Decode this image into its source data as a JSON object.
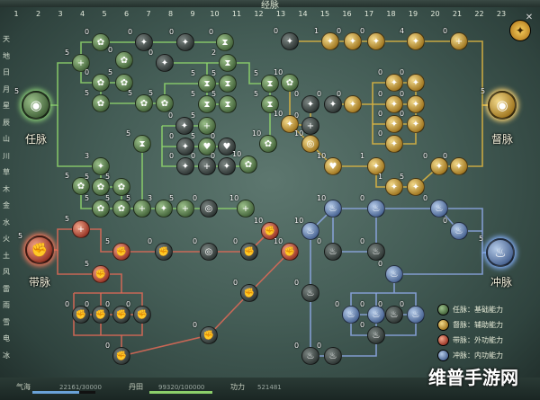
{
  "window": {
    "title": "经脉"
  },
  "columns": [
    "1",
    "2",
    "3",
    "4",
    "5",
    "6",
    "7",
    "8",
    "9",
    "10",
    "11",
    "12",
    "13",
    "14",
    "15",
    "16",
    "17",
    "18",
    "19",
    "20",
    "21",
    "22",
    "23"
  ],
  "rows": [
    "天",
    "地",
    "日",
    "月",
    "星",
    "辰",
    "山",
    "川",
    "草",
    "木",
    "金",
    "水",
    "火",
    "土",
    "风",
    "雷",
    "雨",
    "雪",
    "电",
    "冰"
  ],
  "meridians": [
    {
      "id": "ren",
      "name": "任脉",
      "level": "5",
      "icon": "eye-icon",
      "type": "green"
    },
    {
      "id": "du",
      "name": "督脉",
      "level": "5",
      "icon": "eye-icon",
      "type": "gold"
    },
    {
      "id": "dai",
      "name": "带脉",
      "level": "5",
      "icon": "fist-icon",
      "type": "red"
    },
    {
      "id": "chong",
      "name": "冲脉",
      "level": "5",
      "icon": "flame-icon",
      "type": "blue"
    }
  ],
  "legend": [
    {
      "label": "任脉：基础能力",
      "type": "green"
    },
    {
      "label": "督脉：辅助能力",
      "type": "gold"
    },
    {
      "label": "带脉：外功能力",
      "type": "red"
    },
    {
      "label": "冲脉：内功能力",
      "type": "blue"
    }
  ],
  "status": {
    "qihai_label": "气海",
    "qihai_value": "22161/30000",
    "qihai_fraction": 0.7387,
    "dantian_label": "丹田",
    "dantian_value": "99320/100000",
    "dantian_fraction": 0.9932,
    "gongli_label": "功力",
    "gongli_value": "521481"
  },
  "watermark": "维普手游网",
  "colors": {
    "green": "#6fb64d",
    "gold": "#c9a130",
    "red": "#c0483a",
    "blue": "#6e86c2",
    "dark": "#3a4240"
  },
  "nodes": [
    {
      "id": "g1",
      "type": "green",
      "icon": "plus-icon",
      "level": "5",
      "levelPos": "tl"
    },
    {
      "id": "g2",
      "type": "green",
      "icon": "flower-icon",
      "level": "0",
      "levelPos": "tl"
    },
    {
      "id": "g3",
      "type": "dark",
      "icon": "figure-icon",
      "level": "0",
      "levelPos": "tl"
    },
    {
      "id": "g4",
      "type": "dark",
      "icon": "figure-icon",
      "level": "0",
      "levelPos": "tl"
    },
    {
      "id": "g5",
      "type": "green",
      "icon": "flower-icon",
      "level": "0",
      "levelPos": "tl"
    },
    {
      "id": "g6",
      "type": "green",
      "icon": "flower-icon",
      "level": "0",
      "levelPos": "tl"
    },
    {
      "id": "g7",
      "type": "dark",
      "icon": "figure-icon",
      "level": "0",
      "levelPos": "tl"
    },
    {
      "id": "g8",
      "type": "green",
      "icon": "flower-icon",
      "level": "5",
      "levelPos": "tl"
    },
    {
      "id": "g9",
      "type": "green",
      "icon": "flower-icon",
      "level": "5",
      "levelPos": "tl"
    },
    {
      "id": "g10",
      "type": "green",
      "icon": "flower-icon",
      "level": "5",
      "levelPos": "tl"
    },
    {
      "id": "g11",
      "type": "green",
      "icon": "flower-icon",
      "level": "5",
      "levelPos": "tl"
    },
    {
      "id": "g12",
      "type": "green",
      "icon": "hourglass-icon",
      "level": "0",
      "levelPos": "tl"
    },
    {
      "id": "g13",
      "type": "green",
      "icon": "hourglass-icon",
      "level": "2",
      "levelPos": "tl"
    },
    {
      "id": "g14",
      "type": "green",
      "icon": "hourglass-icon",
      "level": "5",
      "levelPos": "tl"
    },
    {
      "id": "g15",
      "type": "green",
      "icon": "hourglass-icon",
      "level": "5",
      "levelPos": "tl"
    },
    {
      "id": "g16",
      "type": "green",
      "icon": "hourglass-icon",
      "level": "5",
      "levelPos": "tl"
    },
    {
      "id": "g17",
      "type": "green",
      "icon": "hourglass-icon",
      "level": "5",
      "levelPos": "tl"
    },
    {
      "id": "g18",
      "type": "green",
      "icon": "hourglass-icon",
      "level": "5",
      "levelPos": "tl"
    },
    {
      "id": "g19",
      "type": "green",
      "icon": "hourglass-icon",
      "level": "5",
      "levelPos": "tl"
    },
    {
      "id": "g20",
      "type": "green",
      "icon": "flower-icon",
      "level": "10",
      "levelPos": "tl"
    },
    {
      "id": "g21",
      "type": "green",
      "icon": "flower-icon",
      "level": "10",
      "levelPos": "tl"
    },
    {
      "id": "g22",
      "type": "green",
      "icon": "hourglass-icon",
      "level": "5",
      "levelPos": "tl"
    },
    {
      "id": "g23",
      "type": "green",
      "icon": "plus-icon",
      "level": "5",
      "levelPos": "tl"
    },
    {
      "id": "g24",
      "type": "green",
      "icon": "heart-icon",
      "level": "5",
      "levelPos": "tl"
    },
    {
      "id": "g25",
      "type": "dark",
      "icon": "heart-icon",
      "level": "0",
      "levelPos": "tl"
    },
    {
      "id": "g26",
      "type": "dark",
      "icon": "figure-icon",
      "level": "0",
      "levelPos": "tl"
    },
    {
      "id": "g27",
      "type": "dark",
      "icon": "plus-icon",
      "level": "0",
      "levelPos": "tl"
    },
    {
      "id": "g28",
      "type": "dark",
      "icon": "figure-icon",
      "level": "0",
      "levelPos": "tl"
    },
    {
      "id": "g29",
      "type": "dark",
      "icon": "figure-icon",
      "level": "0",
      "levelPos": "tl"
    },
    {
      "id": "g30",
      "type": "dark",
      "icon": "figure-icon",
      "level": "0",
      "levelPos": "tl"
    },
    {
      "id": "g31",
      "type": "green",
      "icon": "flower-icon",
      "level": "10",
      "levelPos": "tl"
    },
    {
      "id": "g32",
      "type": "green",
      "icon": "figure-icon",
      "level": "3",
      "levelPos": "tl"
    },
    {
      "id": "g33",
      "type": "green",
      "icon": "flower-icon",
      "level": "5",
      "levelPos": "tl"
    },
    {
      "id": "g34",
      "type": "green",
      "icon": "flower-icon",
      "level": "5",
      "levelPos": "tl"
    },
    {
      "id": "g35",
      "type": "green",
      "icon": "flower-icon",
      "level": "5",
      "levelPos": "tl"
    },
    {
      "id": "g36",
      "type": "green",
      "icon": "flower-icon",
      "level": "5",
      "levelPos": "tl"
    },
    {
      "id": "g37",
      "type": "green",
      "icon": "flower-icon",
      "level": "5",
      "levelPos": "tl"
    },
    {
      "id": "g38",
      "type": "green",
      "icon": "figure-icon",
      "level": "5",
      "levelPos": "tl"
    },
    {
      "id": "g39",
      "type": "green",
      "icon": "plus-icon",
      "level": "5",
      "levelPos": "tl"
    },
    {
      "id": "g40",
      "type": "green",
      "icon": "figure-icon",
      "level": "3",
      "levelPos": "tl"
    },
    {
      "id": "g41",
      "type": "green",
      "icon": "plus-icon",
      "level": "5",
      "levelPos": "tl"
    },
    {
      "id": "g42",
      "type": "dark",
      "icon": "swirl-icon",
      "level": "0",
      "levelPos": "tl"
    },
    {
      "id": "g43",
      "type": "green",
      "icon": "plus-icon",
      "level": "10",
      "levelPos": "tl"
    },
    {
      "id": "d1",
      "type": "dark",
      "icon": "figure-icon",
      "level": "0",
      "levelPos": "tl"
    },
    {
      "id": "d2",
      "type": "gold",
      "icon": "figure-icon",
      "level": "1",
      "levelPos": "tl"
    },
    {
      "id": "d3",
      "type": "gold",
      "icon": "figure-icon",
      "level": "0",
      "levelPos": "tl"
    },
    {
      "id": "d4",
      "type": "gold",
      "icon": "figure-icon",
      "level": "0",
      "levelPos": "tl"
    },
    {
      "id": "d5",
      "type": "gold",
      "icon": "figure-icon",
      "level": "4",
      "levelPos": "tl"
    },
    {
      "id": "d6",
      "type": "gold",
      "icon": "plus-icon",
      "level": "0",
      "levelPos": "tl"
    },
    {
      "id": "d7",
      "type": "dark",
      "icon": "figure-icon",
      "level": "0",
      "levelPos": "tl"
    },
    {
      "id": "d8",
      "type": "dark",
      "icon": "figure-icon",
      "level": "0",
      "levelPos": "tl"
    },
    {
      "id": "d9",
      "type": "dark",
      "icon": "plus-icon",
      "level": "0",
      "levelPos": "tl"
    },
    {
      "id": "d10",
      "type": "gold",
      "icon": "figure-icon",
      "level": "0",
      "levelPos": "tl"
    },
    {
      "id": "d11",
      "type": "gold",
      "icon": "figure-icon",
      "level": "0",
      "levelPos": "tl"
    },
    {
      "id": "d12",
      "type": "gold",
      "icon": "figure-icon",
      "level": "0",
      "levelPos": "tl"
    },
    {
      "id": "d13",
      "type": "gold",
      "icon": "figure-icon",
      "level": "0",
      "levelPos": "tl"
    },
    {
      "id": "d14",
      "type": "gold",
      "icon": "figure-icon",
      "level": "0",
      "levelPos": "tl"
    },
    {
      "id": "d15",
      "type": "gold",
      "icon": "figure-icon",
      "level": "0",
      "levelPos": "tl"
    },
    {
      "id": "d16",
      "type": "gold",
      "icon": "figure-icon",
      "level": "0",
      "levelPos": "tl"
    },
    {
      "id": "d17",
      "type": "gold",
      "icon": "figure-icon",
      "level": "0",
      "levelPos": "tl"
    },
    {
      "id": "d18",
      "type": "gold",
      "icon": "figure-icon",
      "level": "10",
      "levelPos": "tl"
    },
    {
      "id": "d19",
      "type": "gold",
      "icon": "swirl-icon",
      "level": "10",
      "levelPos": "tl"
    },
    {
      "id": "d20",
      "type": "gold",
      "icon": "heart-icon",
      "level": "10",
      "levelPos": "tl"
    },
    {
      "id": "d21",
      "type": "gold",
      "icon": "figure-icon",
      "level": "1",
      "levelPos": "tl"
    },
    {
      "id": "d22",
      "type": "gold",
      "icon": "figure-icon",
      "level": "1",
      "levelPos": "tl"
    },
    {
      "id": "d23",
      "type": "gold",
      "icon": "figure-icon",
      "level": "5",
      "levelPos": "tl"
    },
    {
      "id": "d24",
      "type": "gold",
      "icon": "figure-icon",
      "level": "0",
      "levelPos": "tl"
    },
    {
      "id": "d25",
      "type": "gold",
      "icon": "figure-icon",
      "level": "0",
      "levelPos": "tl"
    },
    {
      "id": "r1",
      "type": "red",
      "icon": "plus-icon",
      "level": "5",
      "levelPos": "tl"
    },
    {
      "id": "r2",
      "type": "red",
      "icon": "fist-icon",
      "level": "5",
      "levelPos": "tl"
    },
    {
      "id": "r3",
      "type": "dark",
      "icon": "fist-icon",
      "level": "0",
      "levelPos": "tl"
    },
    {
      "id": "r4",
      "type": "dark",
      "icon": "swirl-icon",
      "level": "0",
      "levelPos": "tl"
    },
    {
      "id": "r5",
      "type": "dark",
      "icon": "fist-icon",
      "level": "0",
      "levelPos": "tl"
    },
    {
      "id": "r6",
      "type": "red",
      "icon": "fist-icon",
      "level": "5",
      "levelPos": "tl"
    },
    {
      "id": "r7",
      "type": "red",
      "icon": "fist-icon",
      "level": "10",
      "levelPos": "tl"
    },
    {
      "id": "r8",
      "type": "red",
      "icon": "fist-icon",
      "level": "10",
      "levelPos": "tl"
    },
    {
      "id": "r9",
      "type": "dark",
      "icon": "fist-icon",
      "level": "0",
      "levelPos": "tl"
    },
    {
      "id": "r10",
      "type": "dark",
      "icon": "fist-icon",
      "level": "0",
      "levelPos": "tl"
    },
    {
      "id": "r11",
      "type": "dark",
      "icon": "fist-icon",
      "level": "0",
      "levelPos": "tl"
    },
    {
      "id": "r12",
      "type": "dark",
      "icon": "fist-icon",
      "level": "0",
      "levelPos": "tl"
    },
    {
      "id": "r13",
      "type": "dark",
      "icon": "fist-icon",
      "level": "0",
      "levelPos": "tl"
    },
    {
      "id": "r14",
      "type": "dark",
      "icon": "fist-icon",
      "level": "0",
      "levelPos": "tl"
    },
    {
      "id": "r15",
      "type": "dark",
      "icon": "fist-icon",
      "level": "0",
      "levelPos": "tl"
    },
    {
      "id": "b1",
      "type": "blue",
      "icon": "flame-icon",
      "level": "10",
      "levelPos": "tl"
    },
    {
      "id": "b2",
      "type": "blue",
      "icon": "flame-icon",
      "level": "10",
      "levelPos": "tl"
    },
    {
      "id": "b3",
      "type": "dark",
      "icon": "flame-icon",
      "level": "0",
      "levelPos": "tl"
    },
    {
      "id": "b4",
      "type": "dark",
      "icon": "flame-icon",
      "level": "0",
      "levelPos": "tl"
    },
    {
      "id": "b5",
      "type": "blue",
      "icon": "flame-icon",
      "level": "0",
      "levelPos": "tl"
    },
    {
      "id": "b6",
      "type": "blue",
      "icon": "flame-icon",
      "level": "0",
      "levelPos": "tl"
    },
    {
      "id": "b7",
      "type": "blue",
      "icon": "flame-icon",
      "level": "0",
      "levelPos": "tl"
    },
    {
      "id": "b8",
      "type": "blue",
      "icon": "flame-icon",
      "level": "0",
      "levelPos": "tl"
    },
    {
      "id": "b9",
      "type": "dark",
      "icon": "flame-icon",
      "level": "0",
      "levelPos": "tl"
    },
    {
      "id": "b10",
      "type": "dark",
      "icon": "flame-icon",
      "level": "0",
      "levelPos": "tl"
    },
    {
      "id": "b11",
      "type": "blue",
      "icon": "flame-icon",
      "level": "0",
      "levelPos": "tl"
    },
    {
      "id": "b12",
      "type": "blue",
      "icon": "flame-icon",
      "level": "0",
      "levelPos": "tl"
    },
    {
      "id": "b13",
      "type": "blue",
      "icon": "flame-icon",
      "level": "0",
      "levelPos": "tl"
    },
    {
      "id": "b14",
      "type": "dark",
      "icon": "flame-icon",
      "level": "0",
      "levelPos": "tl"
    },
    {
      "id": "b15",
      "type": "dark",
      "icon": "flame-icon",
      "level": "0",
      "levelPos": "tl"
    },
    {
      "id": "b16",
      "type": "dark",
      "icon": "flame-icon",
      "level": "0",
      "levelPos": "tl"
    }
  ]
}
